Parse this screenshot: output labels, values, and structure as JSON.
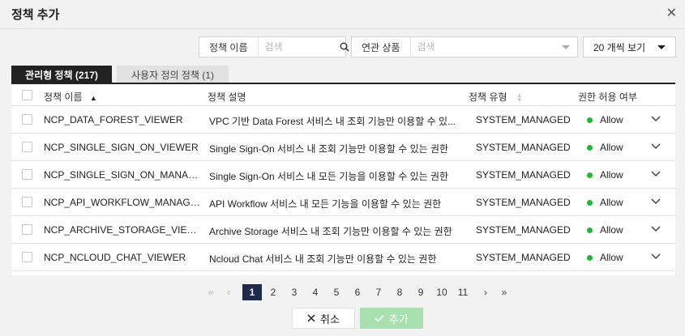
{
  "dialog": {
    "title": "정책 추가"
  },
  "filters": {
    "name_label": "정책 이름",
    "name_placeholder": "검색",
    "product_label": "연관 상품",
    "product_placeholder": "검색",
    "page_size": "20 개씩 보기"
  },
  "tabs": [
    {
      "label": "관리형 정책 (217)",
      "active": true
    },
    {
      "label": "사용자 정의 정책 (1)",
      "active": false
    }
  ],
  "table": {
    "columns": {
      "name": "정책 이름",
      "desc": "정책 설명",
      "type": "정책 유형",
      "perm": "권한 허용 여부"
    },
    "rows": [
      {
        "name": "NCP_DATA_FOREST_VIEWER",
        "desc": "VPC 기반 Data Forest 서비스 내 조회 기능만 이용할 수 있...",
        "type": "SYSTEM_MANAGED",
        "perm": "Allow"
      },
      {
        "name": "NCP_SINGLE_SIGN_ON_VIEWER",
        "desc": "Single Sign-On 서비스 내 조회 기능만 이용할 수 있는 권한",
        "type": "SYSTEM_MANAGED",
        "perm": "Allow"
      },
      {
        "name": "NCP_SINGLE_SIGN_ON_MANAGER",
        "desc": "Single Sign-On 서비스 내 모든 기능을 이용할 수 있는 권한",
        "type": "SYSTEM_MANAGED",
        "perm": "Allow"
      },
      {
        "name": "NCP_API_WORKFLOW_MANAGER",
        "desc": "API Workflow 서비스 내 모든 기능을 이용할 수 있는 권한",
        "type": "SYSTEM_MANAGED",
        "perm": "Allow"
      },
      {
        "name": "NCP_ARCHIVE_STORAGE_VIEWER",
        "desc": "Archive Storage 서비스 내 조회 기능만 이용할 수 있는 권한",
        "type": "SYSTEM_MANAGED",
        "perm": "Allow"
      },
      {
        "name": "NCP_NCLOUD_CHAT_VIEWER",
        "desc": "Ncloud Chat 서비스 내 조회 기능만 이용할 수 있는 권한",
        "type": "SYSTEM_MANAGED",
        "perm": "Allow"
      }
    ]
  },
  "pagination": {
    "pages": [
      "1",
      "2",
      "3",
      "4",
      "5",
      "6",
      "7",
      "8",
      "9",
      "10",
      "11"
    ],
    "current": "1",
    "first": "«",
    "prev": "‹",
    "next": "›",
    "last": "»"
  },
  "actions": {
    "cancel": "취소",
    "add": "추가"
  },
  "colors": {
    "allow_dot": "#1bb934",
    "active_tab": "#222222",
    "current_page": "#1e2a4a",
    "add_button": "#a8e0b0"
  }
}
